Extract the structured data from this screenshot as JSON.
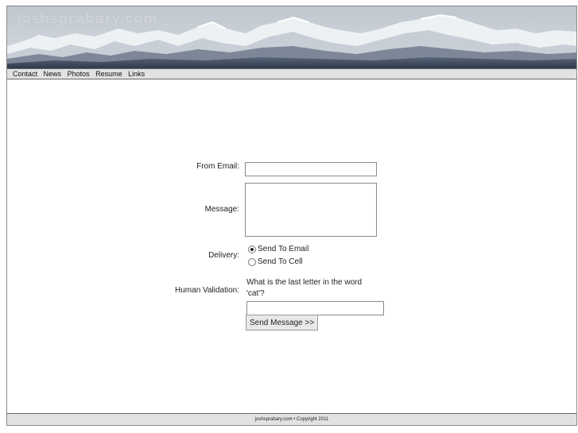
{
  "site": {
    "logo_text": "joshsprabary.com"
  },
  "nav": {
    "items": [
      "Contact",
      "News",
      "Photos",
      "Resume",
      "Links"
    ]
  },
  "form": {
    "from_email_label": "From Email:",
    "from_email_value": "",
    "message_label": "Message:",
    "message_value": "",
    "delivery_label": "Delivery:",
    "delivery_options": [
      {
        "label": "Send To Email",
        "selected": true
      },
      {
        "label": "Send To Cell",
        "selected": false
      }
    ],
    "human_validation_label": "Human Validation:",
    "validation_question": "What is the last letter in the word 'cat'?",
    "validation_answer_value": "",
    "submit_label": "Send Message >>"
  },
  "footer": {
    "text": "joshsprabary.com • Copyright 2011"
  },
  "colors": {
    "nav_bg": "#e2e2e2",
    "border": "#8a8a8a",
    "sky": "#c9d0d8",
    "snow": "#f4f6f8",
    "rock": "#5b6573"
  }
}
